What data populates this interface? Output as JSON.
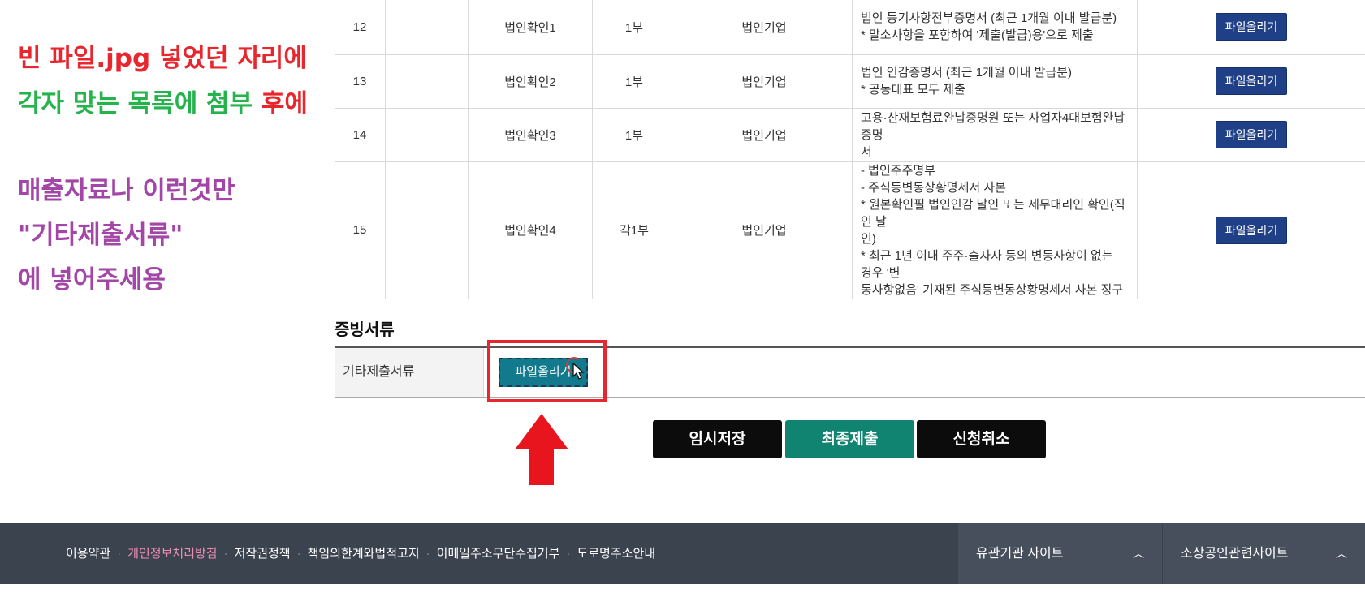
{
  "annotation": {
    "line1_red": "빈 파일.jpg 넣었던 자리에",
    "line2_green": "각자 맞는 목록에 첨부 ",
    "line2_red": "후에",
    "line3": "매출자료나 이런것만",
    "line4": "\"기타제출서류\"",
    "line5": "에 넣어주세용"
  },
  "table": {
    "rows": [
      {
        "no": "12",
        "name": "법인확인1",
        "qty": "1부",
        "type": "법인기업",
        "desc": [
          "법인 등기사항전부증명서 (최근 1개월 이내 발급분)",
          "* 말소사항을 포함하여 '제출(발급)용'으로 제출"
        ],
        "button": "파일올리기"
      },
      {
        "no": "13",
        "name": "법인확인2",
        "qty": "1부",
        "type": "법인기업",
        "desc": [
          "법인 인감증명서 (최근 1개월 이내 발급분)",
          "* 공동대표 모두 제출"
        ],
        "button": "파일올리기"
      },
      {
        "no": "14",
        "name": "법인확인3",
        "qty": "1부",
        "type": "법인기업",
        "desc": [
          "고용·산재보험료완납증명원 또는 사업자4대보험완납증명",
          "서"
        ],
        "button": "파일올리기"
      },
      {
        "no": "15",
        "name": "법인확인4",
        "qty": "각1부",
        "type": "법인기업",
        "desc": [
          "- 법인주주명부",
          "- 주식등변동상황명세서 사본",
          "* 원본확인필 법인인감 날인 또는 세무대리인 확인(직인 날",
          "인)",
          "* 최근 1년 이내 주주·출자자 등의 변동사항이 없는 경우 '변",
          "동사항없음' 기재된 주식등변동상황명세서 사본 징구"
        ],
        "button": "파일올리기"
      }
    ]
  },
  "evidence": {
    "title": "증빙서류",
    "label": "기타제출서류",
    "button": "파일올리기"
  },
  "actions": {
    "temp_save": "임시저장",
    "final_submit": "최종제출",
    "cancel": "신청취소"
  },
  "footer": {
    "links": [
      "이용약관",
      "개인정보처리방침",
      "저작권정책",
      "책임의한계와법적고지",
      "이메일주소무단수집거부",
      "도로명주소안내"
    ],
    "site1": "유관기관 사이트",
    "site2": "소상공인관련사이트"
  },
  "colors": {
    "upload_button": "#1f3f87",
    "evidence_button": "#127a8d",
    "final_submit": "#118371",
    "footer_bg": "#3b434f",
    "highlight_red": "#e8262d"
  }
}
